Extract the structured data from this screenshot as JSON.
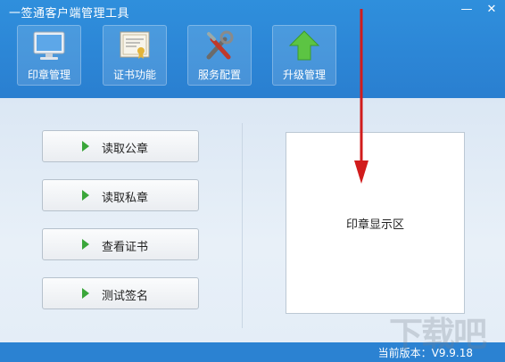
{
  "window": {
    "title": "一签通客户端管理工具",
    "min_icon": "minimize-icon",
    "close_icon": "close-icon"
  },
  "toolbar": {
    "items": [
      {
        "label": "印章管理",
        "icon": "monitor-icon",
        "active": true
      },
      {
        "label": "证书功能",
        "icon": "certificate-icon",
        "active": true
      },
      {
        "label": "服务配置",
        "icon": "tools-icon",
        "active": true
      },
      {
        "label": "升级管理",
        "icon": "upgrade-arrow-icon",
        "active": true
      }
    ]
  },
  "actions": [
    {
      "label": "读取公章"
    },
    {
      "label": "读取私章"
    },
    {
      "label": "查看证书"
    },
    {
      "label": "测试签名"
    }
  ],
  "stamp_area": {
    "label": "印章显示区"
  },
  "status": {
    "version": "当前版本：V9.9.18"
  },
  "watermark": "下载吧",
  "colors": {
    "titlebar": "#2c86d6",
    "status": "#2b82d2",
    "annotation_arrow": "#d11c1c",
    "play_arrow": "#3aa63a"
  }
}
